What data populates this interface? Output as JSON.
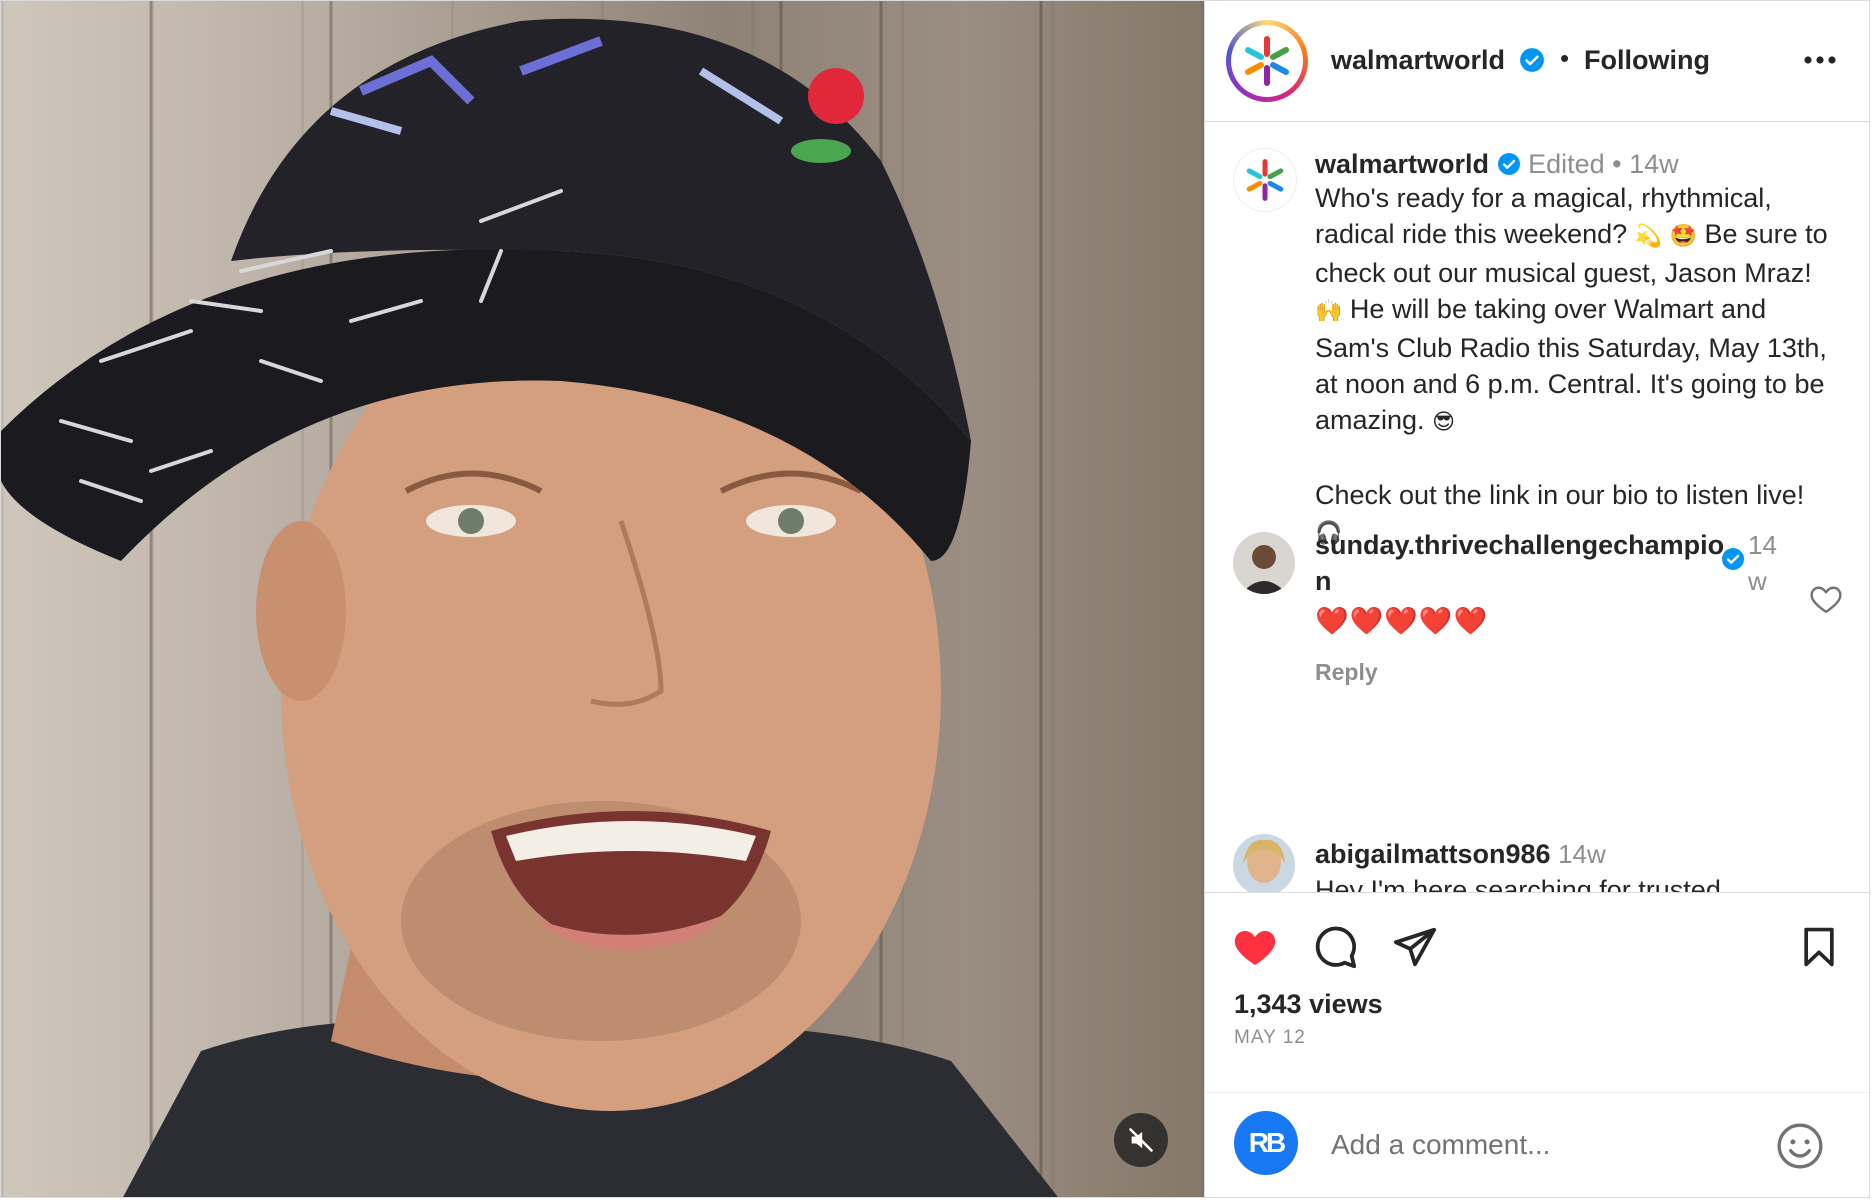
{
  "post": {
    "username": "walmartworld",
    "follow_separator": "•",
    "follow_status": "Following",
    "more_icon": "more-horizontal-icon"
  },
  "caption": {
    "username": "walmartworld",
    "edited": "Edited",
    "separator": "•",
    "time": "14w",
    "paragraph1_a": "Who's ready for a magical, rhythmical, radical ride this weekend?",
    "emoji1": "💫",
    "emoji2": "🤩",
    "paragraph1_b": "Be sure to check out our musical guest, Jason Mraz!",
    "emoji3": "🙌",
    "paragraph1_c": "He will be taking over Walmart and Sam's Club Radio this Saturday, May 13th, at noon and 6 p.m. Central. It's going to be amazing.",
    "emoji4": "😎",
    "paragraph2": "Check out the link in our bio to listen live!",
    "emoji5": "🎧"
  },
  "comments": [
    {
      "username": "sunday.thrivechallengechampion",
      "verified": true,
      "time": "14w",
      "text": "❤️❤️❤️❤️❤️",
      "reply_label": "Reply"
    },
    {
      "username": "abigailmattson986",
      "time": "14w",
      "text": "Hey I'm here searching for trusted"
    }
  ],
  "actions": {
    "liked": true,
    "views": "1,343 views",
    "date": "MAY 12"
  },
  "comment_bar": {
    "avatar_initials": "RB",
    "placeholder": "Add a comment..."
  },
  "colors": {
    "like_red": "#ff3040",
    "verified_blue": "#0095f6",
    "walmart_spark": "#ffc220"
  }
}
